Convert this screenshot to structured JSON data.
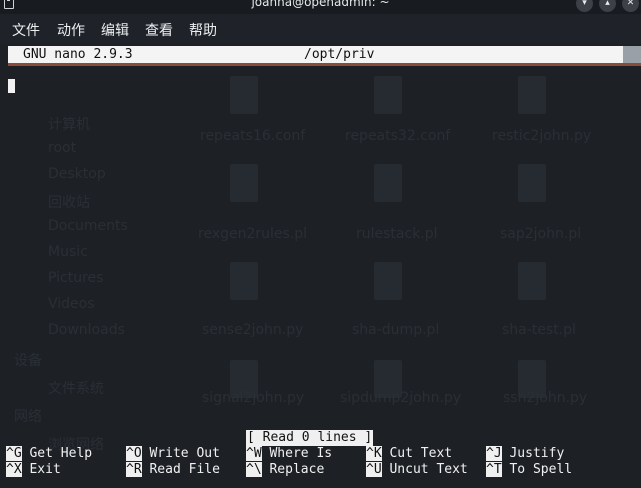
{
  "window": {
    "title": "joanna@openadmin: ~"
  },
  "menubar": {
    "items": [
      "文件",
      "动作",
      "编辑",
      "查看",
      "帮助"
    ]
  },
  "nano": {
    "version": "GNU nano 2.9.3",
    "filepath": "/opt/priv",
    "status": "[ Read 0 lines ]",
    "shortcuts": [
      [
        {
          "key": "^G",
          "label": "Get Help"
        },
        {
          "key": "^X",
          "label": "Exit"
        }
      ],
      [
        {
          "key": "^O",
          "label": "Write Out"
        },
        {
          "key": "^R",
          "label": "Read File"
        }
      ],
      [
        {
          "key": "^W",
          "label": "Where Is"
        },
        {
          "key": "^\\",
          "label": "Replace"
        }
      ],
      [
        {
          "key": "^K",
          "label": "Cut Text"
        },
        {
          "key": "^U",
          "label": "Uncut Text"
        }
      ],
      [
        {
          "key": "^J",
          "label": "Justify"
        },
        {
          "key": "^T",
          "label": "To Spell"
        }
      ]
    ]
  },
  "background": {
    "sidebar": [
      "计算机",
      "root",
      "Desktop",
      "回收站",
      "Documents",
      "Music",
      "Pictures",
      "Videos",
      "Downloads",
      "设备",
      "文件系统",
      "网络",
      "浏览网络"
    ],
    "files": [
      "repeats16.conf",
      "repeats32.conf",
      "restic2john.py",
      "rexgen2rules.pl",
      "rulestack.pl",
      "sap2john.pl",
      "sense2john.py",
      "sha-dump.pl",
      "sha-test.pl",
      "signal2john.py",
      "sipdump2john.py",
      "ssh2john.py"
    ]
  },
  "colors": {
    "terminal_bg": "#1d2126",
    "header_bg": "#f4f4f4",
    "cursor": "#f2f2f2"
  }
}
